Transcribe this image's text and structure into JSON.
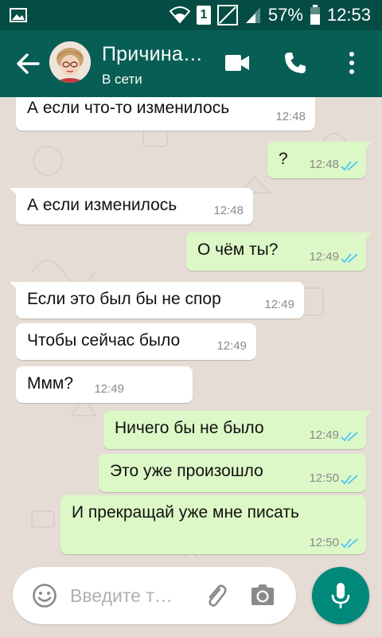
{
  "status_bar": {
    "battery": "57%",
    "time": "12:53",
    "sim": "1",
    "icons": [
      "gallery-icon",
      "wifi-icon",
      "sim-icon",
      "no-signal-icon",
      "signal-icon",
      "battery-icon"
    ]
  },
  "app_bar": {
    "title": "Причина…",
    "status": "В сети",
    "icons": [
      "back-arrow-icon",
      "avatar",
      "video-call-icon",
      "phone-call-icon",
      "more-vert-icon"
    ]
  },
  "messages": [
    {
      "dir": "in",
      "text": "А если что-то изменилось",
      "time": "12:48"
    },
    {
      "dir": "out",
      "text": "?",
      "time": "12:48",
      "read": true
    },
    {
      "dir": "in",
      "text": "А если изменилось",
      "time": "12:48"
    },
    {
      "dir": "out",
      "text": "О чём ты?",
      "time": "12:49",
      "read": true
    },
    {
      "dir": "in",
      "text": "Если это был бы не спор",
      "time": "12:49"
    },
    {
      "dir": "in",
      "text": "Чтобы сейчас было",
      "time": "12:49"
    },
    {
      "dir": "in",
      "text": "Ммм?",
      "time": "12:49"
    },
    {
      "dir": "out",
      "text": "Ничего бы не было",
      "time": "12:49",
      "read": true
    },
    {
      "dir": "out",
      "text": "Это уже произошло",
      "time": "12:50",
      "read": true
    },
    {
      "dir": "out",
      "text": "И прекращай уже мне писать",
      "time": "12:50",
      "read": true
    }
  ],
  "input": {
    "placeholder": "Введите т…"
  },
  "colors": {
    "status_bar": "#054d44",
    "app_bar": "#075e54",
    "chat_bg": "#e5ddd5",
    "bubble_in": "#ffffff",
    "bubble_out": "#dcf8c6",
    "read_ticks": "#4fc3f7",
    "mic_button": "#00897b"
  }
}
